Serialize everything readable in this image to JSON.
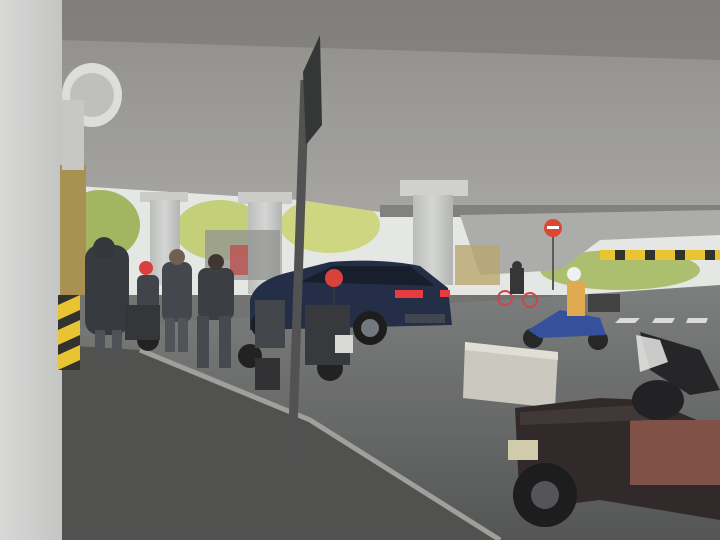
{
  "scene": {
    "description_label": "",
    "signs": {
      "no_entry_sign": {
        "color": "#d9412b"
      }
    },
    "palette": {
      "ceiling": "#8d8c88",
      "ceiling_dark": "#6f6e6a",
      "pillar": "#c9cbc9",
      "road": "#5c5d5c",
      "sidewalk": "#4f4f4d",
      "car_body": "#1c2740",
      "taillight": "#e8343a",
      "foliage": "#b9c86a",
      "sky": "#e6e9e6",
      "hazard_yellow": "#e8c12a",
      "balloon_red": "#d83a35",
      "rider_blue": "#2d4a9a"
    }
  }
}
